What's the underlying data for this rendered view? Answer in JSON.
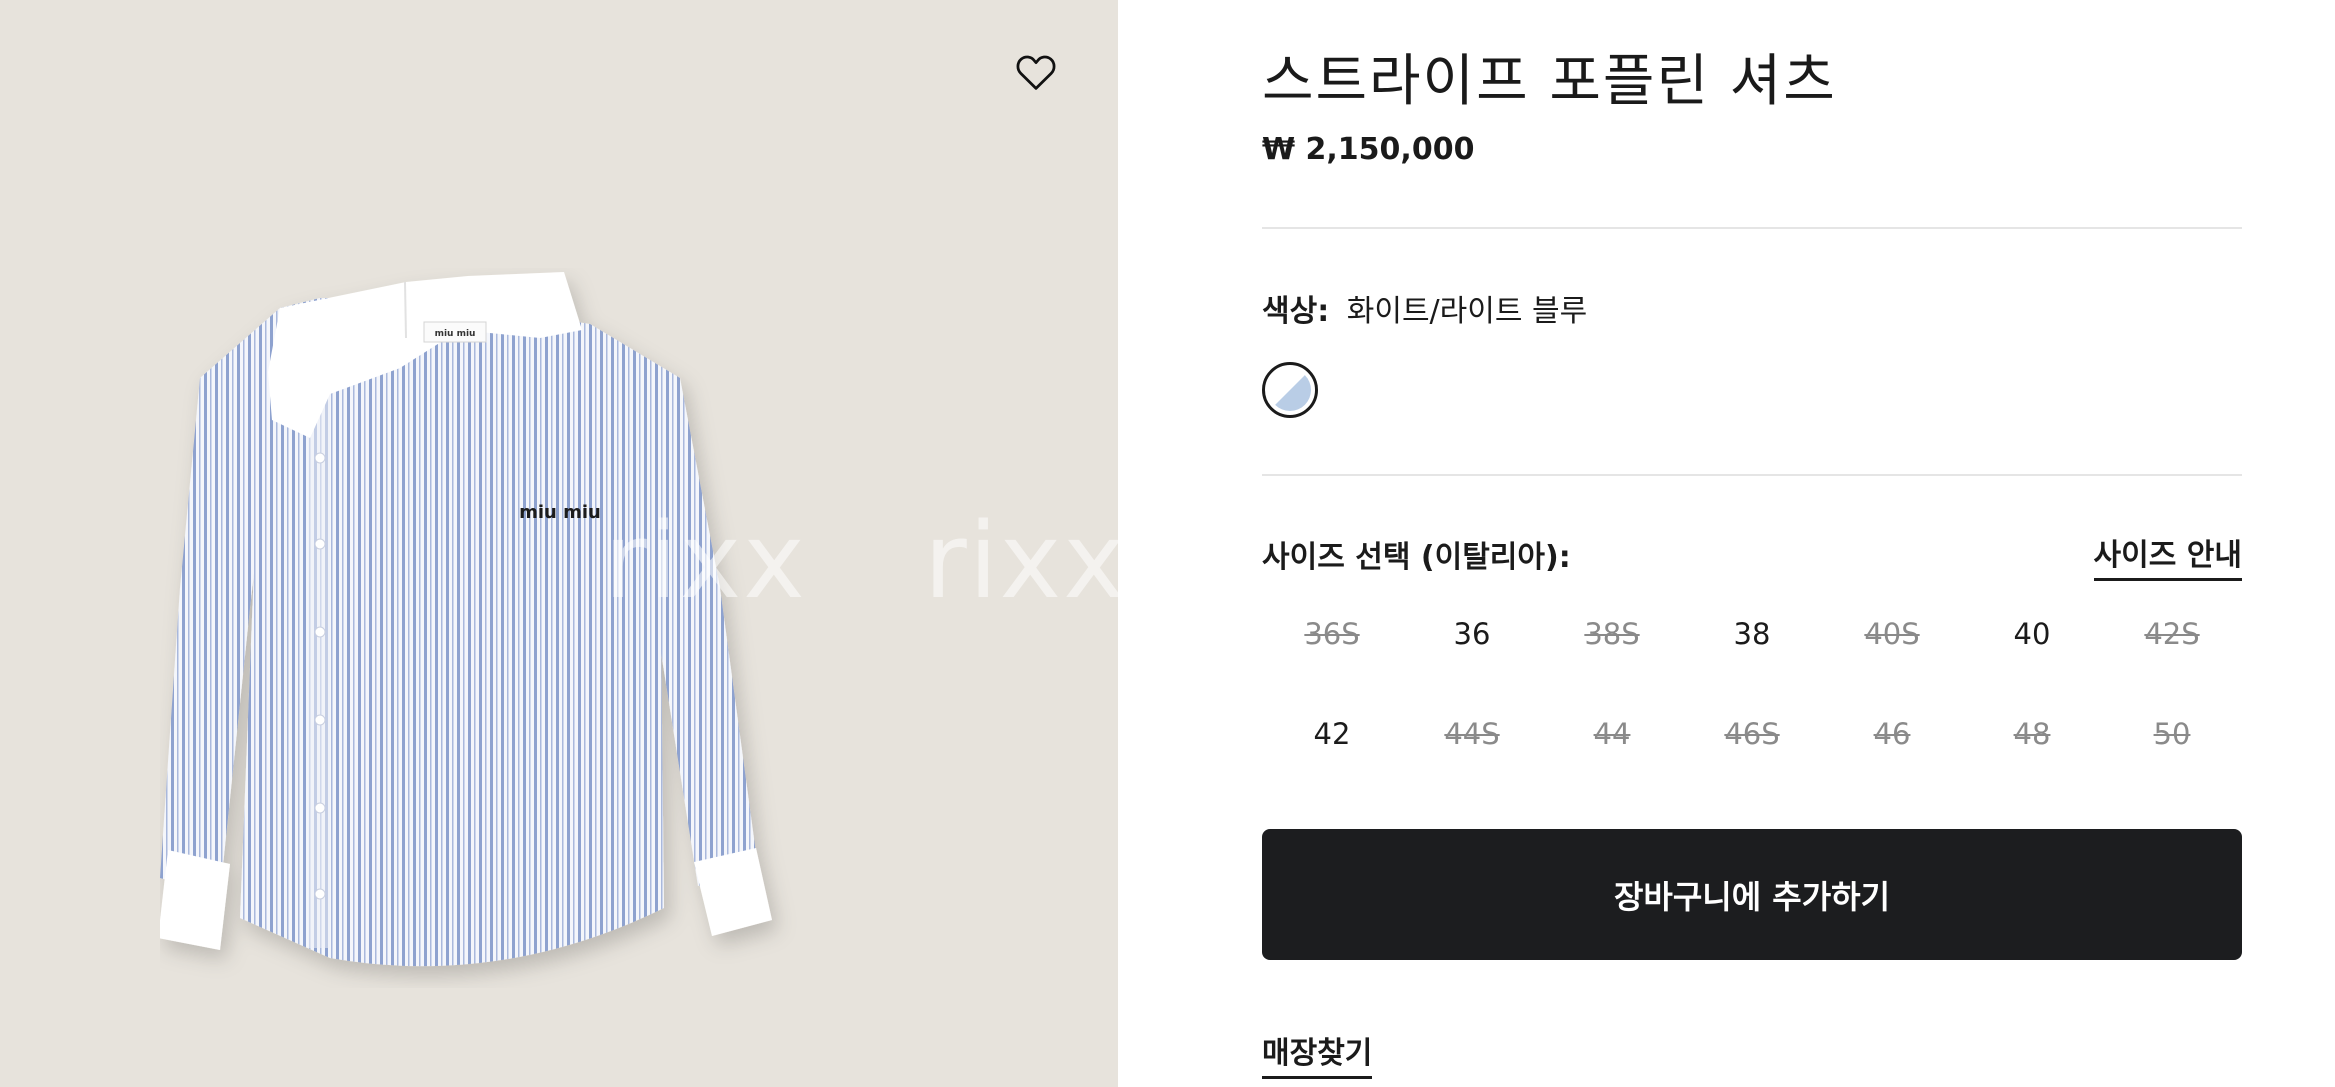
{
  "gallery": {
    "wishlist_icon": "heart-outline-icon",
    "watermark": [
      "rixx",
      "rixx"
    ],
    "shirt_logo": "miu miu"
  },
  "product": {
    "title": "스트라이프 포플린 셔츠",
    "price": "₩ 2,150,000"
  },
  "color": {
    "label": "색상:",
    "value": "화이트/라이트 블루",
    "swatch_colors": [
      "#ffffff",
      "#b9cde6"
    ]
  },
  "size": {
    "title": "사이즈 선택 (이탈리아):",
    "guide_label": "사이즈 안내",
    "options": [
      {
        "label": "36S",
        "available": false
      },
      {
        "label": "36",
        "available": true
      },
      {
        "label": "38S",
        "available": false
      },
      {
        "label": "38",
        "available": true
      },
      {
        "label": "40S",
        "available": false
      },
      {
        "label": "40",
        "available": true
      },
      {
        "label": "42S",
        "available": false
      },
      {
        "label": "42",
        "available": true
      },
      {
        "label": "44S",
        "available": false
      },
      {
        "label": "44",
        "available": false
      },
      {
        "label": "46S",
        "available": false
      },
      {
        "label": "46",
        "available": false
      },
      {
        "label": "48",
        "available": false
      },
      {
        "label": "50",
        "available": false
      }
    ]
  },
  "actions": {
    "add_to_cart": "장바구니에 추가하기",
    "find_store": "매장찾기"
  }
}
